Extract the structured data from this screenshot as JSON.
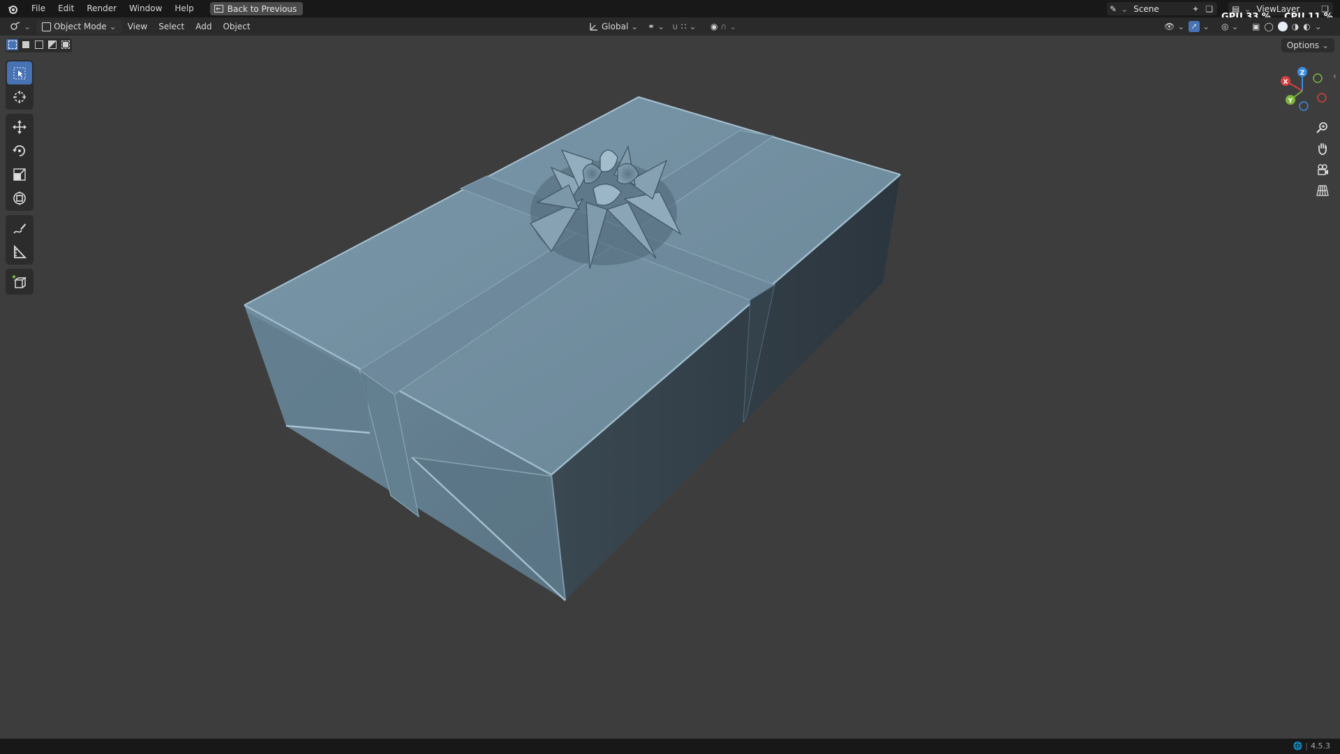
{
  "menu": {
    "file": "File",
    "edit": "Edit",
    "render": "Render",
    "window": "Window",
    "help": "Help",
    "back_to_previous": "Back to Previous"
  },
  "scene": {
    "scene_name": "Scene",
    "view_layer": "ViewLayer"
  },
  "stats": {
    "gpu": "GPU 33 %",
    "cpu": "CPU 11 %"
  },
  "header": {
    "mode": "Object Mode",
    "view": "View",
    "select": "Select",
    "add": "Add",
    "object": "Object",
    "orientation": "Global"
  },
  "options_label": "Options",
  "gizmo": {
    "x": "X",
    "y": "Y",
    "z": "Z"
  },
  "colors": {
    "accent": "#4772b3",
    "axis_x": "#d8413f",
    "axis_y": "#7cb63a",
    "axis_z": "#3b8de0",
    "gift": "#6f8a9c"
  },
  "icons": {
    "select_box": "select-box-icon",
    "cursor": "cursor-icon",
    "move": "move-icon",
    "rotate": "rotate-icon",
    "scale": "scale-icon",
    "transform": "transform-icon",
    "annotate": "annotate-icon",
    "measure": "measure-icon",
    "add_cube": "add-cube-icon",
    "zoom": "zoom-icon",
    "pan": "hand-icon",
    "camera": "camera-icon",
    "grid": "grid-icon"
  },
  "status": {
    "version": "4.5.3"
  }
}
